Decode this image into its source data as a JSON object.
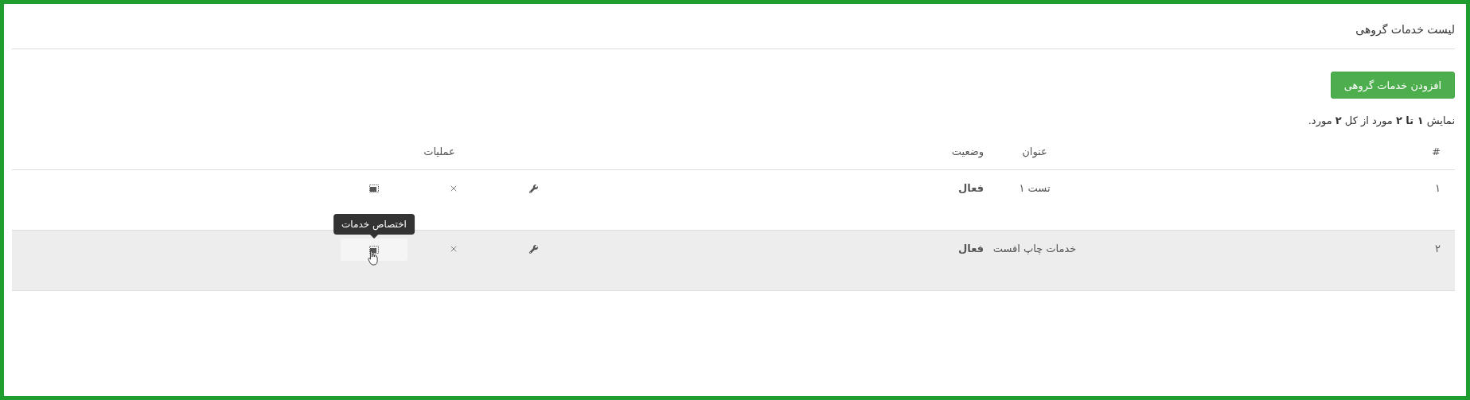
{
  "page_title": "لیست خدمات گروهی",
  "add_button": "افزودن خدمات گروهی",
  "summary": "نمایش **۱ تا ۲** مورد از کل **۲** مورد.",
  "table": {
    "columns": [
      "#",
      "عنوان",
      "وضعیت",
      "عملیات"
    ],
    "rows": [
      {
        "index": "۱",
        "title": "تست ۱",
        "status": "فعال",
        "highlighted": false,
        "tooltip": null
      },
      {
        "index": "۲",
        "title": "خدمات چاپ افست",
        "status": "فعال",
        "highlighted": true,
        "tooltip": "اختصاص خدمات"
      }
    ]
  }
}
